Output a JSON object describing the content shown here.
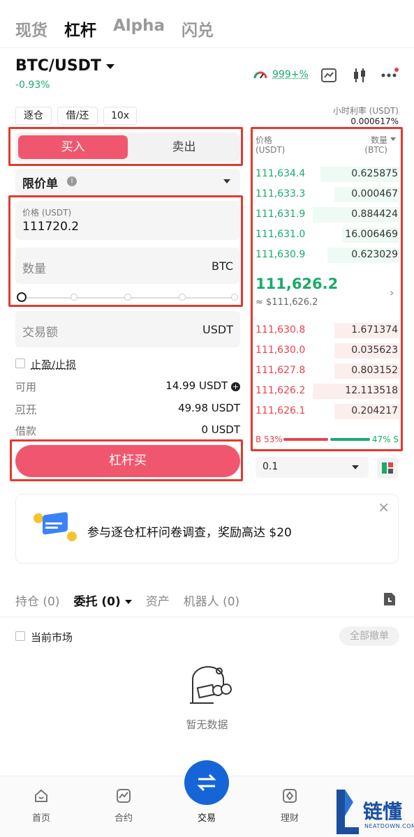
{
  "top_tabs": [
    "现货",
    "杠杆",
    "Alpha",
    "闪兑"
  ],
  "pair": {
    "name": "BTC/USDT",
    "change": "-0.93%"
  },
  "header_icons": {
    "gauge_value": "999+%"
  },
  "margin_chips": [
    "逐仓",
    "借/还",
    "10x"
  ],
  "interest": {
    "label": "小时利率 (USDT)",
    "value": "0.000617%"
  },
  "trade_form": {
    "buy_label": "买入",
    "sell_label": "卖出",
    "order_type": "限价单",
    "price_label": "价格 (USDT)",
    "price_value": "111720.2",
    "qty_placeholder": "数量",
    "qty_unit": "BTC",
    "amount_placeholder": "交易额",
    "amount_unit": "USDT",
    "tp_sl_label": "止盈/止损",
    "slider_percent": 0
  },
  "balances": [
    {
      "label": "可用",
      "value": "14.99 USDT"
    },
    {
      "label": "可开",
      "value": "49.98 USDT"
    },
    {
      "label": "借款",
      "value": "0 USDT"
    }
  ],
  "submit_label": "杠杆买",
  "orderbook": {
    "price_header": "价格",
    "price_unit": "(USDT)",
    "qty_header": "数量",
    "qty_unit": "(BTC)",
    "asks": [
      {
        "price": "111,634.4",
        "qty": "0.625875",
        "depth": 0.55
      },
      {
        "price": "111,633.3",
        "qty": "0.000467",
        "depth": 0.45
      },
      {
        "price": "111,631.9",
        "qty": "0.884424",
        "depth": 0.6
      },
      {
        "price": "111,631.0",
        "qty": "16.006469",
        "depth": 0.4
      },
      {
        "price": "111,630.9",
        "qty": "0.623029",
        "depth": 0.5
      }
    ],
    "last_price": "111,626.2",
    "last_price_usd": "≈ $111,626.2",
    "bids": [
      {
        "price": "111,630.8",
        "qty": "1.671374",
        "depth": 0.45
      },
      {
        "price": "111,630.0",
        "qty": "0.035623",
        "depth": 0.45
      },
      {
        "price": "111,627.8",
        "qty": "0.803152",
        "depth": 0.45
      },
      {
        "price": "111,626.2",
        "qty": "12.113518",
        "depth": 0.6
      },
      {
        "price": "111,626.1",
        "qty": "0.204217",
        "depth": 0.45
      }
    ],
    "buy_ratio": "B 53%",
    "sell_ratio": "47% S",
    "buy_ratio_value": 53,
    "precision": "0.1"
  },
  "banner": {
    "text": "参与逐仓杠杆问卷调查，奖励高达 $20"
  },
  "bottom_tabs": [
    "持仓 (0)",
    "委托 (0)",
    "资产",
    "机器人 (0)"
  ],
  "filter": {
    "label": "当前市场",
    "cancel_all": "全部撤单"
  },
  "empty_text": "暂无数据",
  "nav": [
    "首页",
    "合约",
    "交易",
    "理财"
  ],
  "watermark": {
    "name": "链懂",
    "sub": "NEATDOWN.COM"
  },
  "colors": {
    "green": "#1aab6a",
    "red": "#e8424e",
    "accent": "#f0576e",
    "nav_center": "#1565d8"
  }
}
